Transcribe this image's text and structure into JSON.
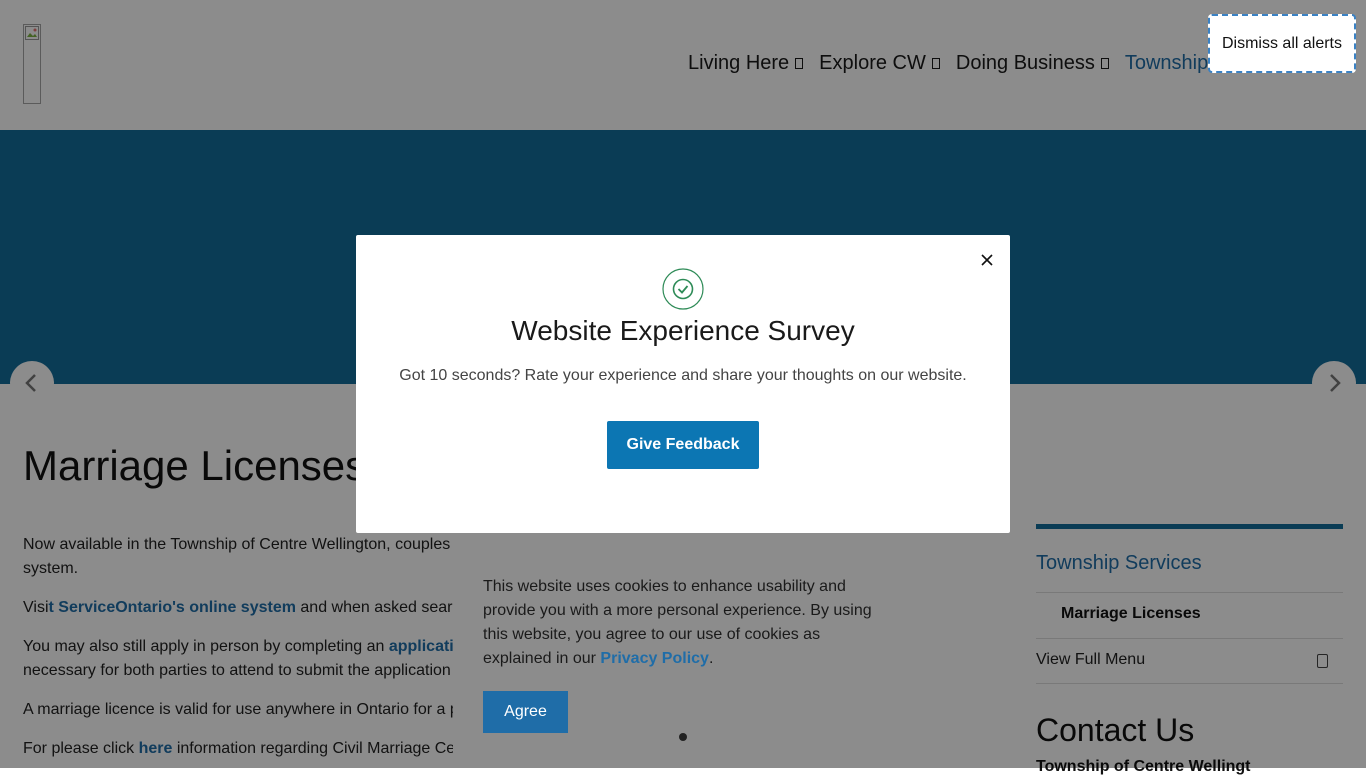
{
  "header": {
    "nav": [
      {
        "label": "Living Here"
      },
      {
        "label": "Explore CW"
      },
      {
        "label": "Doing Business"
      },
      {
        "label": "Township"
      }
    ],
    "dismiss_alerts": "Dismiss all alerts"
  },
  "main": {
    "title": "Marriage Licenses",
    "p1_line1": "Now available in the Township of Centre Wellington, couples",
    "p1_line2": "system.",
    "p2_prefix": "Visi",
    "p2_link": "t ServiceOntario's online system",
    "p2_suffix": " and when asked sear",
    "p3_prefix": "You may also still apply in person by completing an ",
    "p3_link": "applicati",
    "p3_line2": "necessary for both parties to attend to submit the application",
    "p4": "A marriage licence is valid for use anywhere in Ontario for a p",
    "p5_prefix": "For please click ",
    "p5_link": "here",
    "p5_suffix": " information regarding Civil Marriage Ce"
  },
  "sidebar": {
    "heading": "Township Services",
    "current": "Marriage Licenses",
    "full_menu": "View Full Menu",
    "contact_heading": "Contact Us",
    "contact_sub": "Township of Centre Wellingt"
  },
  "modal": {
    "title": "Website Experience Survey",
    "text": "Got 10 seconds? Rate your experience and share your thoughts on our website.",
    "button": "Give Feedback"
  },
  "cookie": {
    "text": "This website uses cookies to enhance usability and provide you with a more personal experience. By using this website, you agree to our use of cookies as explained in our ",
    "link": "Privacy Policy",
    "end": ".",
    "agree": "Agree"
  },
  "colors": {
    "brand": "#136d9b",
    "link": "#1f6da8",
    "button": "#0c76b3",
    "check": "#2e8b57"
  },
  "icons": [
    "broken-image-icon",
    "caret-icon",
    "chevron-left-icon",
    "chevron-right-icon",
    "close-icon",
    "check-circle-icon",
    "menu-toggle-icon"
  ]
}
